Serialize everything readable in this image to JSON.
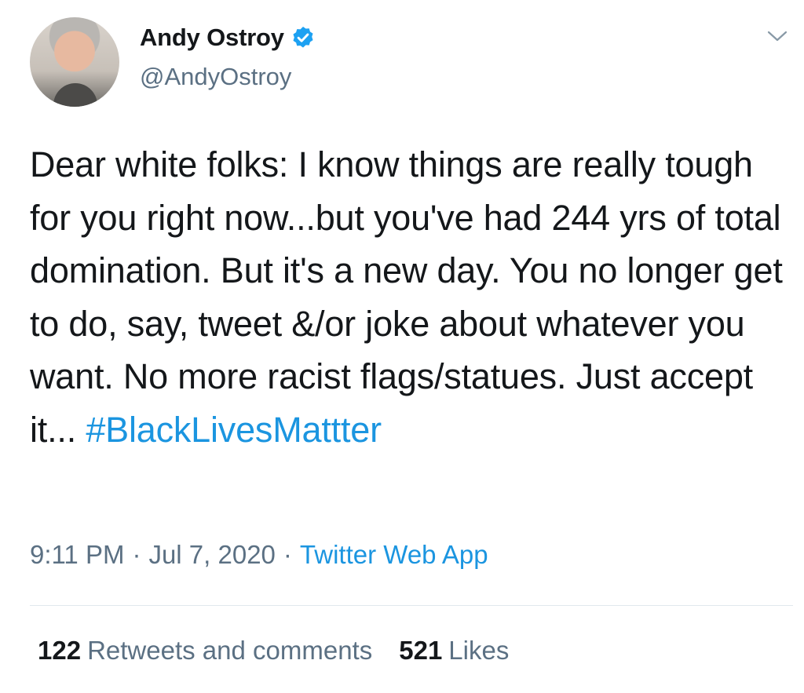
{
  "author": {
    "name": "Andy Ostroy",
    "handle": "@AndyOstroy",
    "verified": true,
    "avatar_icon": "profile-photo"
  },
  "tweet": {
    "text": "Dear white folks: I know things are really tough for you right now...but you've had 244 yrs of total domination. But it's a new day. You no longer get to do, say, tweet &/or joke about whatever you want. No more racist flags/statues. Just accept it... ",
    "hashtag": "#BlackLivesMattter"
  },
  "meta": {
    "time": "9:11 PM",
    "separator1": "·",
    "date": "Jul 7, 2020",
    "separator2": "·",
    "source": "Twitter Web App"
  },
  "stats": {
    "retweets_count": "122",
    "retweets_label": "Retweets and comments",
    "likes_count": "521",
    "likes_label": "Likes"
  },
  "colors": {
    "link": "#1b95e0",
    "secondary_text": "#5b7083",
    "primary_text": "#14171a",
    "divider": "#e1e8ed"
  },
  "icons": {
    "verified": "verified-badge-icon",
    "menu": "chevron-down-icon"
  }
}
